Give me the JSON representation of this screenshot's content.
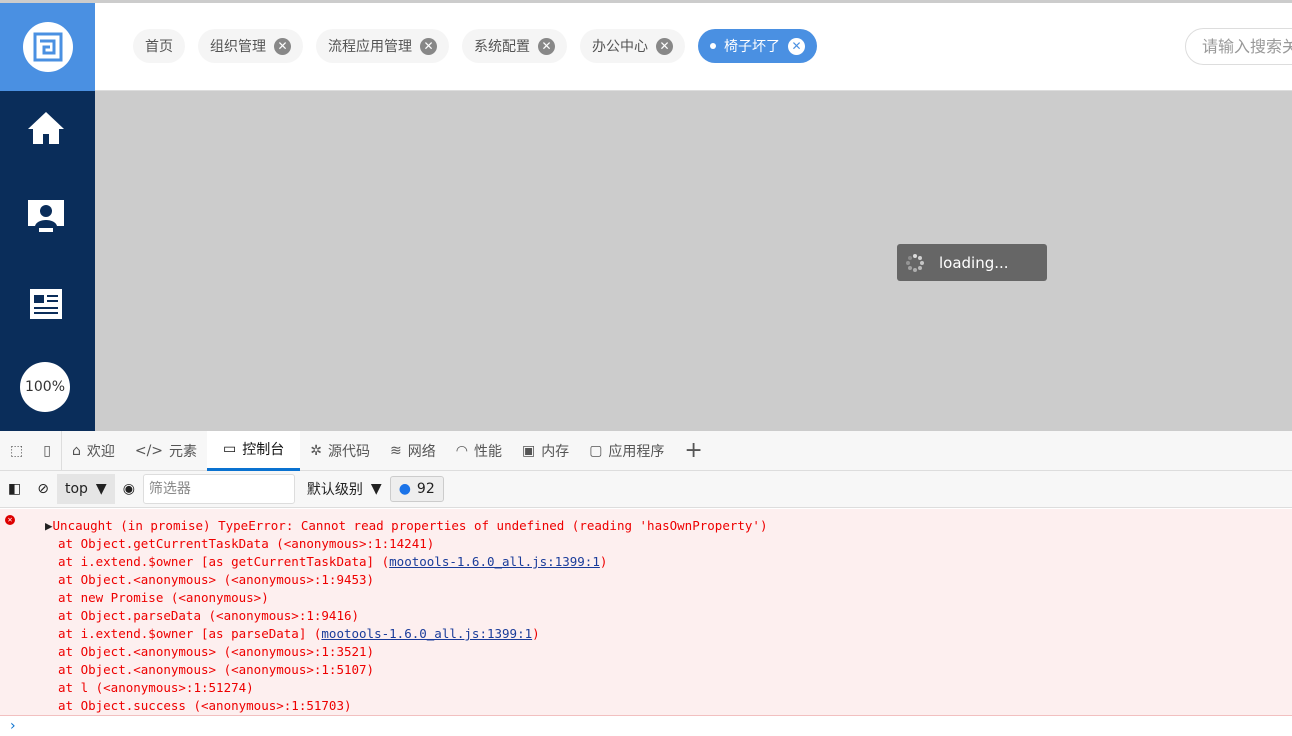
{
  "sidebar": {
    "zoom": "100%"
  },
  "header": {
    "tabs": [
      {
        "label": "首页",
        "closable": false
      },
      {
        "label": "组织管理",
        "closable": true
      },
      {
        "label": "流程应用管理",
        "closable": true
      },
      {
        "label": "系统配置",
        "closable": true
      },
      {
        "label": "办公中心",
        "closable": true
      },
      {
        "label": "椅子坏了",
        "closable": true,
        "active": true
      }
    ],
    "search_placeholder": "请输入搜索关键字"
  },
  "content": {
    "loading": "loading..."
  },
  "devtools": {
    "tabs": [
      "欢迎",
      "元素",
      "控制台",
      "源代码",
      "网络",
      "性能",
      "内存",
      "应用程序"
    ],
    "active": "控制台"
  },
  "console": {
    "context": "top",
    "filter_placeholder": "筛选器",
    "level": "默认级别",
    "issues": "92",
    "error": {
      "message": "Uncaught (in promise) TypeError: Cannot read properties of undefined (reading 'hasOwnProperty')",
      "stack": [
        {
          "text": "at Object.getCurrentTaskData (<anonymous>:1:14241)"
        },
        {
          "text": "at i.extend.$owner [as getCurrentTaskData] (",
          "link": "mootools-1.6.0_all.js:1399:1",
          "after": ")"
        },
        {
          "text": "at Object.<anonymous> (<anonymous>:1:9453)"
        },
        {
          "text": "at new Promise (<anonymous>)"
        },
        {
          "text": "at Object.parseData (<anonymous>:1:9416)"
        },
        {
          "text": "at i.extend.$owner [as parseData] (",
          "link": "mootools-1.6.0_all.js:1399:1",
          "after": ")"
        },
        {
          "text": "at Object.<anonymous> (<anonymous>:1:3521)"
        },
        {
          "text": "at Object.<anonymous> (<anonymous>:1:5107)"
        },
        {
          "text": "at l (<anonymous>:1:51274)"
        },
        {
          "text": "at Object.success (<anonymous>:1:51703)"
        }
      ]
    }
  },
  "colors": {
    "accent": "#4a90e2",
    "sidebar": "#0a2d5a",
    "error": "#e00000"
  }
}
